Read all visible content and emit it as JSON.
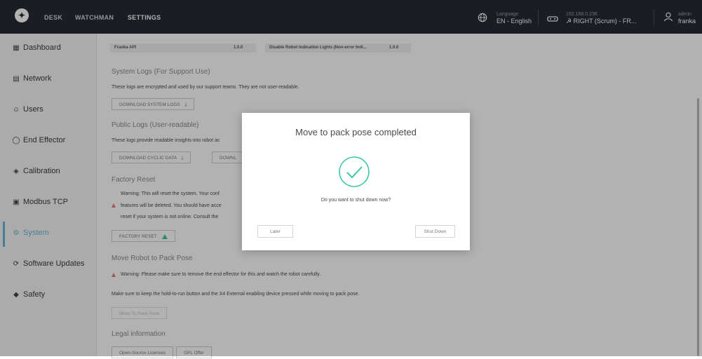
{
  "topbar": {
    "logo": "✦",
    "nav": [
      "DESK",
      "WATCHMAN",
      "SETTINGS"
    ],
    "active_nav": "SETTINGS",
    "language": {
      "label": "Language",
      "value": "EN - English",
      "icon": "globe-icon"
    },
    "robot": {
      "ip": "192.168.0.236",
      "value": "☭ RIGHT (Scrum) - FR...",
      "icon": "robot-icon"
    },
    "user": {
      "role": "admin",
      "name": "franka",
      "icon": "user-icon"
    }
  },
  "sidebar": {
    "items": [
      {
        "label": "Dashboard",
        "icon": "dashboard-icon"
      },
      {
        "label": "Network",
        "icon": "network-icon"
      },
      {
        "label": "Users",
        "icon": "users-icon"
      },
      {
        "label": "End Effector",
        "icon": "end-effector-icon"
      },
      {
        "label": "Calibration",
        "icon": "calibration-icon"
      },
      {
        "label": "Modbus TCP",
        "icon": "modbus-icon"
      },
      {
        "label": "System",
        "icon": "system-icon"
      },
      {
        "label": "Software Updates",
        "icon": "software-updates-icon"
      },
      {
        "label": "Safety",
        "icon": "safety-icon"
      }
    ],
    "active": "System"
  },
  "main": {
    "api_row": {
      "left_name": "Franka API",
      "left_version": "1.0.0",
      "right_name": "Disable Robot Indication Lights (Non-error Indi...",
      "right_version": "1.0.0"
    },
    "system_logs": {
      "title": "System Logs (For Support Use)",
      "desc": "These logs are encrypted and used by our support teams. They are not user-readable.",
      "button": "DOWNLOAD SYSTEM LOGS"
    },
    "public_logs": {
      "title": "Public Logs (User-readable)",
      "desc": "These logs provide readable insights into robot ac",
      "button1": "DOWNLOAD CYCLIC DATA",
      "button2": "DOWNL"
    },
    "factory_reset": {
      "title": "Factory Reset",
      "warn_line1": "Warning: This will reset the system. Your conf",
      "warn_line2": "features will be deleted. You should have acce",
      "warn_line3": "reset if your system is not online. Consult the",
      "button": "FACTORY RESET"
    },
    "pack_pose": {
      "title": "Move Robot to Pack Pose",
      "warning": "Warning: Please make sure to remove the end effector for this and watch the robot carefully.",
      "desc": "Make sure to keep the hold-to-run button and the X4 External enabling device pressed while moving to pack pose.",
      "button": "Move To Pack Pose"
    },
    "legal": {
      "title": "Legal information",
      "button1": "Open-Source Licenses",
      "button2": "GPL Offer"
    }
  },
  "modal": {
    "title": "Move to pack pose completed",
    "question": "Do you want to shut down now?",
    "later": "Later",
    "shutdown": "Shut Down",
    "accent": "#3ec9a7"
  }
}
